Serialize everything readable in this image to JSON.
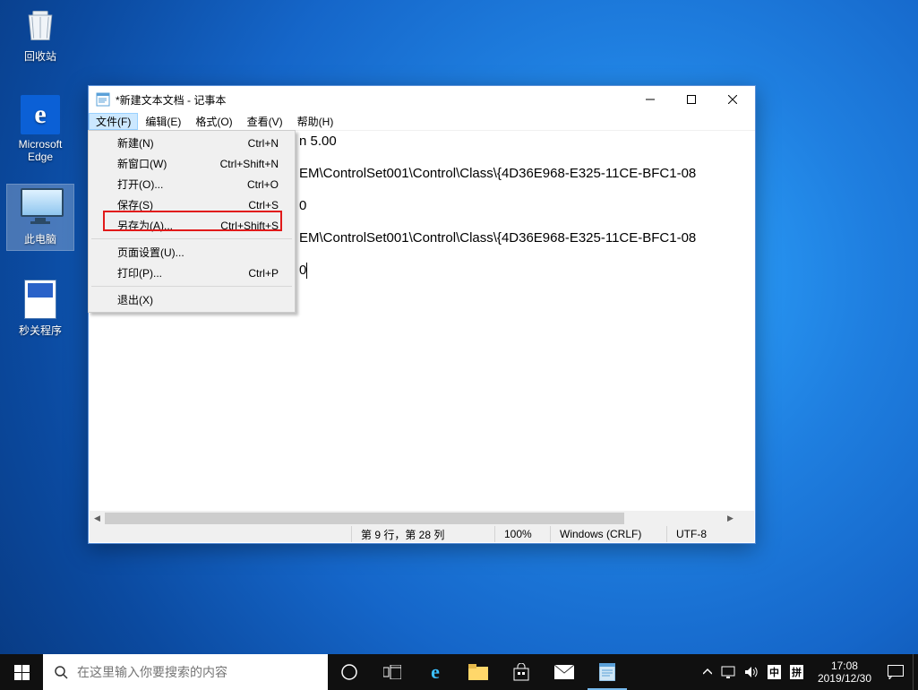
{
  "desktop": {
    "icons": {
      "recycle": "回收站",
      "edge": "Microsoft Edge",
      "thispc": "此电脑",
      "shutdown": "秒关程序"
    }
  },
  "notepad": {
    "title": "*新建文本文档 - 记事本",
    "menubar": {
      "file": "文件(F)",
      "edit": "编辑(E)",
      "format": "格式(O)",
      "view": "查看(V)",
      "help": "帮助(H)"
    },
    "filemenu": [
      {
        "label": "新建(N)",
        "shortcut": "Ctrl+N"
      },
      {
        "label": "新窗口(W)",
        "shortcut": "Ctrl+Shift+N"
      },
      {
        "label": "打开(O)...",
        "shortcut": "Ctrl+O"
      },
      {
        "label": "保存(S)",
        "shortcut": "Ctrl+S"
      },
      {
        "label": "另存为(A)...",
        "shortcut": "Ctrl+Shift+S"
      },
      {
        "sep": true
      },
      {
        "label": "页面设置(U)...",
        "shortcut": ""
      },
      {
        "label": "打印(P)...",
        "shortcut": "Ctrl+P"
      },
      {
        "sep": true
      },
      {
        "label": "退出(X)",
        "shortcut": ""
      }
    ],
    "content": {
      "l1a": "n 5.00",
      "l2": "",
      "l3a": "EM\\ControlSet001\\Control\\Class\\{4D36E968-E325-11CE-BFC1-08",
      "l4": "",
      "l5a": "0",
      "l6": "",
      "l7a": "EM\\ControlSet001\\Control\\Class\\{4D36E968-E325-11CE-BFC1-08",
      "l8": "",
      "l9a": "0"
    },
    "status": {
      "pos": "第 9 行，第 28 列",
      "zoom": "100%",
      "eol": "Windows (CRLF)",
      "enc": "UTF-8"
    }
  },
  "taskbar": {
    "search_placeholder": "在这里输入你要搜索的内容",
    "ime1": "中",
    "ime2": "拼",
    "time": "17:08",
    "date": "2019/12/30"
  }
}
